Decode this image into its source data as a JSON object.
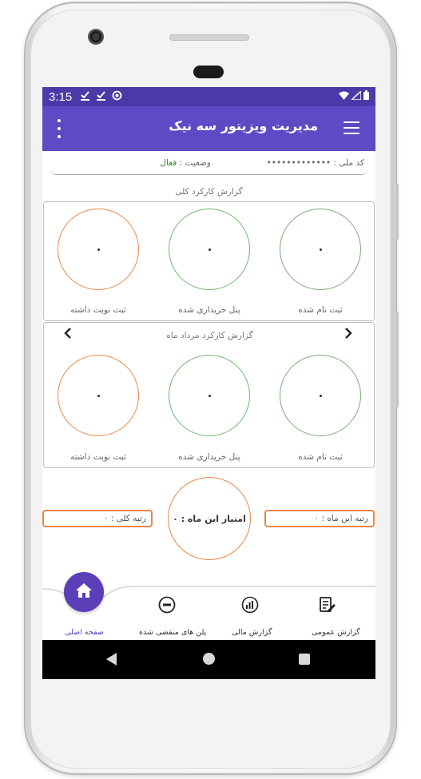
{
  "status_bar": {
    "time": "3:15",
    "icons": [
      "download-done-icon",
      "download-done-icon",
      "sync-icon"
    ],
    "right_icons": [
      "wifi-icon",
      "signal-icon",
      "battery-icon"
    ]
  },
  "app_bar": {
    "title": "مدیریت ویزیتور سه نیک",
    "menu_icon": "hamburger-icon",
    "overflow_icon": "more-vert-icon"
  },
  "info": {
    "national_code_label": "کد ملی :",
    "national_code_value": "•••••••••••••",
    "status_label": "وضعیت :",
    "status_value": "فعال"
  },
  "overall_report": {
    "title": "گزارش کارکرد کلی",
    "items": [
      {
        "label": "ثبت نام شده",
        "value": "•"
      },
      {
        "label": "پنل خریداری شده",
        "value": "•"
      },
      {
        "label": "ثبت نوبت داشته",
        "value": "•"
      }
    ]
  },
  "monthly_report": {
    "title": "گزارش کارکرد مرداد ماه",
    "items": [
      {
        "label": "ثبت نام شده",
        "value": "•"
      },
      {
        "label": "پنل خریداری شده",
        "value": "•"
      },
      {
        "label": "ثبت نوبت داشته",
        "value": "•"
      }
    ]
  },
  "ranking": {
    "month_rank": "رتبه این ماه : ۰",
    "score": "امتیاز این ماه : ۰",
    "total_rank": "رتبه کلی : ۰"
  },
  "bottom_nav": {
    "items": [
      {
        "label": "گزارش عمومی",
        "icon": "document-edit-icon"
      },
      {
        "label": "گزارش مالی",
        "icon": "finance-chart-icon"
      },
      {
        "label": "پلن های منقضی شده",
        "icon": "minus-circle-icon"
      },
      {
        "label": "صفحه اصلی",
        "icon": "home-icon"
      }
    ]
  },
  "colors": {
    "primary": "#5c4bc4",
    "status_bar": "#4a3aa8",
    "accent_orange": "#e8884a",
    "accent_green": "#6cb86c",
    "active_status": "#2e8b2e"
  }
}
